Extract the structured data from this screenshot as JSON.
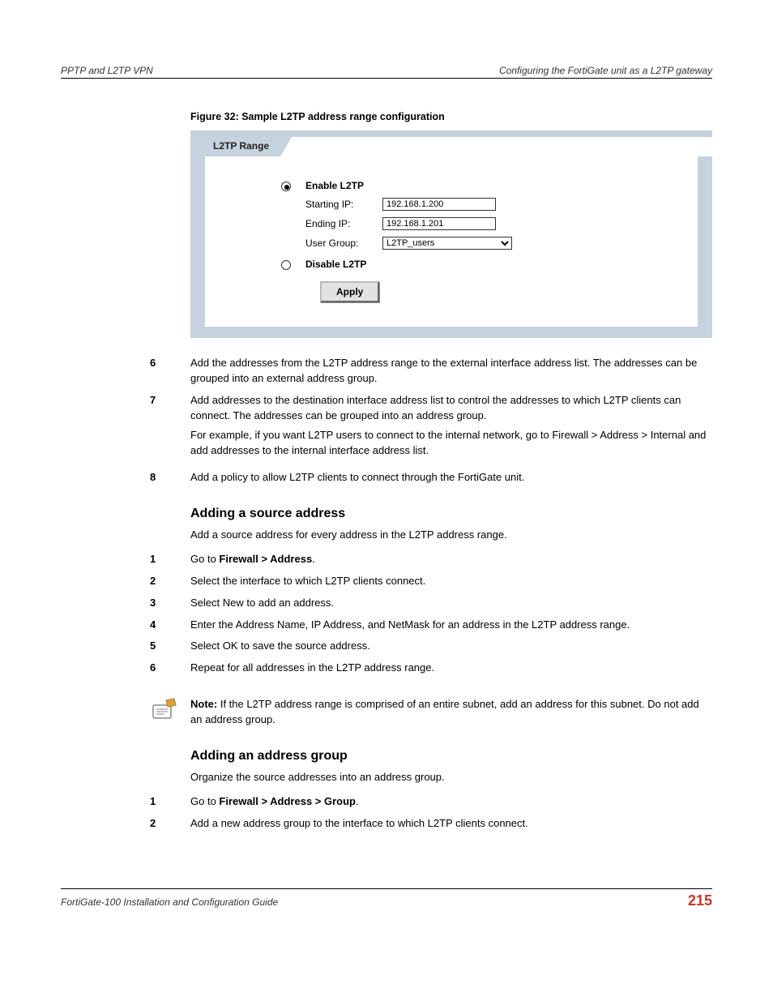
{
  "header": {
    "left": "PPTP and L2TP VPN",
    "right": "Configuring the FortiGate unit as a L2TP gateway"
  },
  "figure": {
    "caption": "Figure 32: Sample L2TP address range configuration",
    "tab_label": "L2TP Range",
    "form": {
      "enable_label": "Enable L2TP",
      "starting_ip_label": "Starting IP:",
      "starting_ip_value": "192.168.1.200",
      "ending_ip_label": "Ending IP:",
      "ending_ip_value": "192.168.1.201",
      "user_group_label": "User Group:",
      "user_group_value": "L2TP_users",
      "disable_label": "Disable L2TP",
      "apply_label": "Apply"
    }
  },
  "steps_after_figure": [
    {
      "num": "6",
      "text": "Add the addresses from the L2TP address range to the external interface address list. The addresses can be grouped into an external address group."
    },
    {
      "num": "7",
      "text": "Add addresses to the destination interface address list to control the addresses to which L2TP clients can connect. The addresses can be grouped into an address group.",
      "extra": "For example, if you want L2TP users to connect to the internal network, go to Firewall > Address > Internal and add addresses to the internal interface address list."
    },
    {
      "num": "8",
      "text": "Add a policy to allow L2TP clients to connect through the FortiGate unit."
    }
  ],
  "section_source": {
    "heading": "Adding a source address",
    "intro": "Add a source address for every address in the L2TP address range.",
    "steps": [
      {
        "num": "1",
        "pre": "Go to ",
        "bold": "Firewall > Address",
        "post": "."
      },
      {
        "num": "2",
        "text": "Select the interface to which L2TP clients connect."
      },
      {
        "num": "3",
        "text": "Select New to add an address."
      },
      {
        "num": "4",
        "text": "Enter the Address Name, IP Address, and NetMask for an address in the L2TP address range."
      },
      {
        "num": "5",
        "text": "Select OK to save the source address."
      },
      {
        "num": "6",
        "text": "Repeat for all addresses in the L2TP address range."
      }
    ],
    "note_label": "Note:",
    "note_text": " If the L2TP address range is comprised of an entire subnet, add an address for this subnet. Do not add an address group."
  },
  "section_group": {
    "heading": "Adding an address group",
    "intro": "Organize the source addresses into an address group.",
    "steps": [
      {
        "num": "1",
        "pre": "Go to ",
        "bold": "Firewall > Address > Group",
        "post": "."
      },
      {
        "num": "2",
        "text": "Add a new address group to the interface to which L2TP clients connect."
      }
    ]
  },
  "footer": {
    "left": "FortiGate-100 Installation and Configuration Guide",
    "right": "215"
  }
}
